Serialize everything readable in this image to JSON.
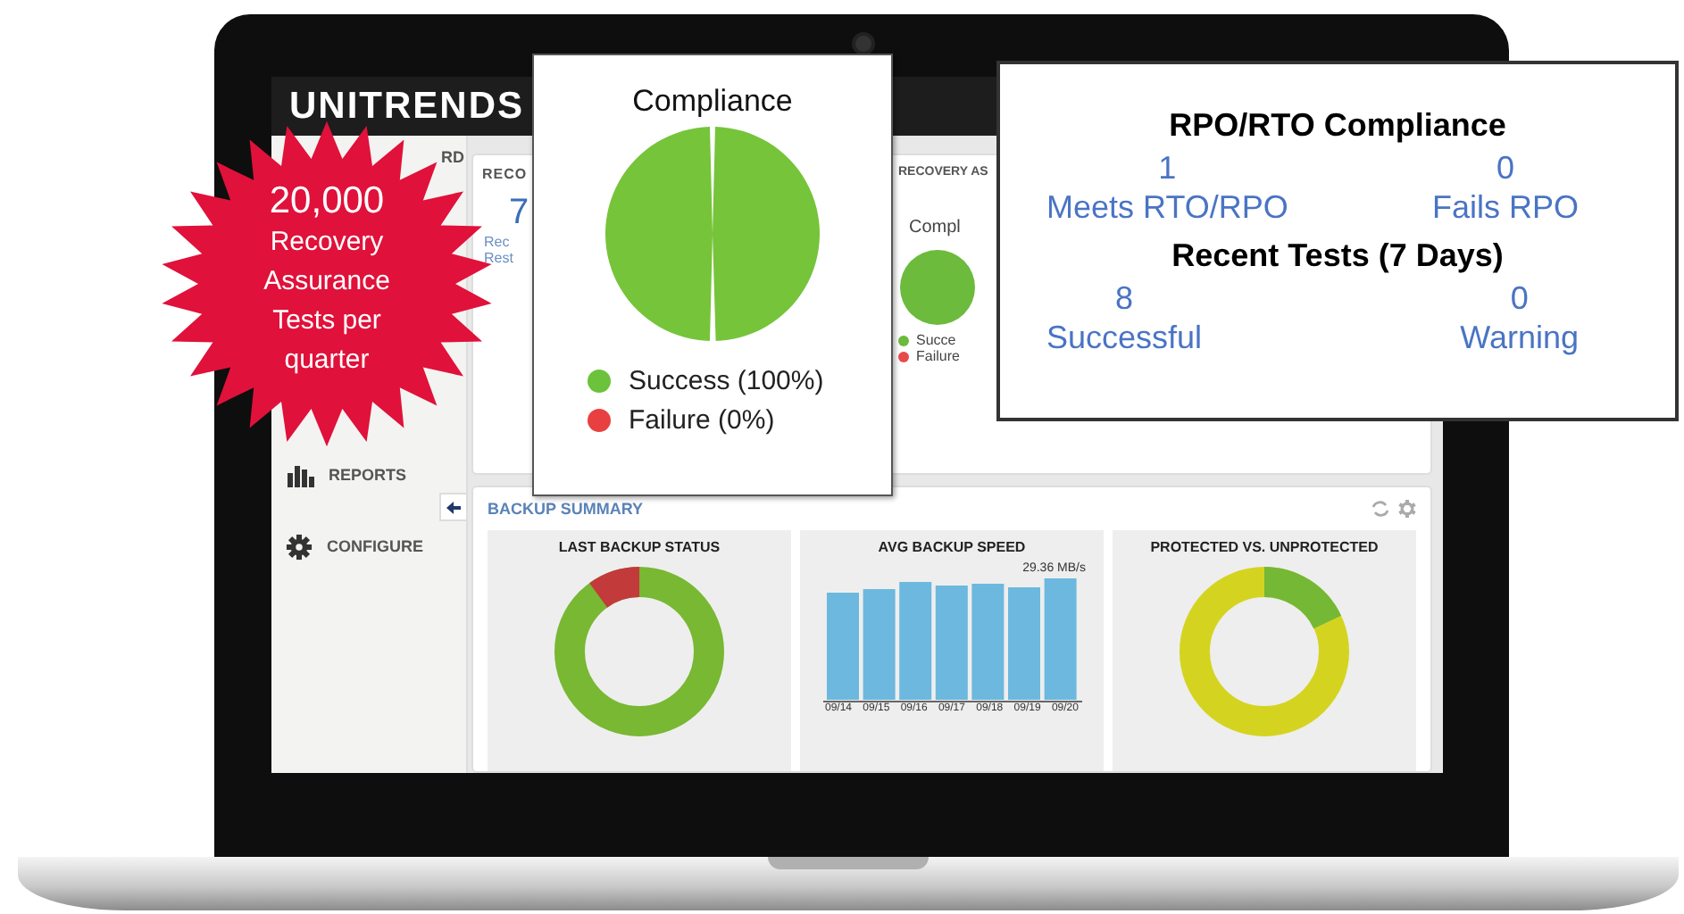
{
  "app": {
    "logo": "UNITRENDS"
  },
  "sidebar": {
    "items": [
      {
        "label": "RD",
        "kind": "plain"
      },
      {
        "label": "REPORTS",
        "kind": "reports"
      },
      {
        "label": "CONFIGURE",
        "kind": "configure"
      }
    ]
  },
  "top_panels": [
    {
      "kind": "stat",
      "title": "RECO",
      "value": "7",
      "lines": [
        "Rec",
        "Rest"
      ]
    },
    {
      "kind": "pie",
      "title": "RECOVERY AS",
      "chart_title": "Compl",
      "legend": [
        {
          "label": "Succe",
          "color": "#6cbb3c"
        },
        {
          "label": "Failure",
          "color": "#e84a4a"
        }
      ]
    }
  ],
  "backup_summary": {
    "title": "BACKUP SUMMARY",
    "cards": [
      {
        "kind": "status_donut",
        "title": "LAST BACKUP STATUS"
      },
      {
        "kind": "bars",
        "title": "AVG BACKUP SPEED",
        "peak_label": "29.36 MB/s",
        "labels": [
          "09/14",
          "09/15",
          "09/16",
          "09/17",
          "09/18",
          "09/19",
          "09/20"
        ]
      },
      {
        "kind": "protect_donut",
        "title": "PROTECTED VS. UNPROTECTED"
      }
    ]
  },
  "compliance_callout": {
    "title": "Compliance",
    "legend": [
      {
        "label": "Success (100%)",
        "color": "#6cc23a"
      },
      {
        "label": "Failure (0%)",
        "color": "#e84040"
      }
    ]
  },
  "rpo_callout": {
    "sections": [
      {
        "title": "RPO/RTO Compliance",
        "stats": [
          {
            "value": "1",
            "label": "Meets RTO/RPO"
          },
          {
            "value": "0",
            "label": "Fails RPO"
          }
        ]
      },
      {
        "title": "Recent Tests (7 Days)",
        "stats": [
          {
            "value": "8",
            "label": "Successful"
          },
          {
            "value": "0",
            "label": "Warning"
          }
        ]
      }
    ]
  },
  "badge": {
    "headline": "20,000",
    "text": "Recovery Assurance Tests per quarter"
  }
}
